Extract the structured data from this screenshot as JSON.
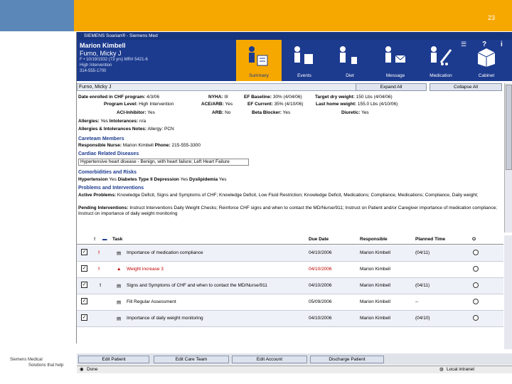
{
  "slide": {
    "number": "23",
    "footer": [
      "Siemens Medical",
      "Solutions that help"
    ]
  },
  "window": {
    "title": "SIEMENS Soarian® - Siemens Med"
  },
  "header": {
    "user_name": "Marion Kimbell",
    "patient_name": "Furno, Micky J",
    "lines": [
      "F • 10/19/1932 (73 yrs) MR# 5421-6",
      "High Intervention",
      "314-555-1700"
    ]
  },
  "nav": {
    "items": [
      {
        "label": "Summary",
        "icon": "summary-person-icon",
        "active": true
      },
      {
        "label": "Events",
        "icon": "events-person-icon"
      },
      {
        "label": "Diet",
        "icon": "diet-person-icon"
      },
      {
        "label": "Message",
        "icon": "message-person-icon"
      },
      {
        "label": "Medication",
        "icon": "medication-person-icon"
      },
      {
        "label": "Cabinet",
        "icon": "cabinet-box-icon"
      }
    ]
  },
  "patient_bar": {
    "name": "Furno, Micky J",
    "expand_label": "Expand All",
    "collapse_label": "Collapse All"
  },
  "summary": {
    "enrolled": {
      "label": "Date enrolled in CHF program:",
      "value": "4/3/06"
    },
    "nyha": {
      "label": "NYHA:",
      "value": "III"
    },
    "ef_baseline": {
      "label": "EF Baseline:",
      "value": "30% (4/04/06)"
    },
    "target_weight": {
      "label": "Target dry weight:",
      "value": "150 Lbs (4/04/06)"
    },
    "program_level": {
      "label": "Program Level:",
      "value": "High Intervention"
    },
    "acearb": {
      "label": "ACE/ARB:",
      "value": "Yes"
    },
    "ef_current": {
      "label": "EF Current:",
      "value": "35% (4/10/06)"
    },
    "last_weight": {
      "label": "Last home weight:",
      "value": "155.0 Lbs (4/10/06)"
    },
    "aci": {
      "label": "ACI-Inhibitor:",
      "value": "Yes"
    },
    "arb": {
      "label": "ARB:",
      "value": "No"
    },
    "beta": {
      "label": "Beta Blocker:",
      "value": "Yes"
    },
    "diuretic": {
      "label": "Diuretic:",
      "value": "Yes"
    },
    "allergies": {
      "label": "Allergies:",
      "value": "Yes",
      "intolerances_label": "Intolerances:",
      "intolerances_value": "n/a"
    },
    "allergy_notes": {
      "label": "Allergies & Intolerances Notes:",
      "value": "Allergy: PCN"
    }
  },
  "careteam": {
    "title": "Careteam Members",
    "nurse_label": "Responsible Nurse:",
    "nurse": "Marion Kimbell",
    "phone_label": "Phone:",
    "phone": "215-555-3300"
  },
  "cardiac": {
    "title": "Cardiac Related Diseases",
    "value": "Hypertensive heart disease - Benign, with heart failure; Left Heart Failure"
  },
  "comorbid": {
    "title": "Comorbidities and Risks",
    "items": [
      {
        "label": "Hypertension",
        "value": "Yes"
      },
      {
        "label": "Diabetes Type II",
        "value": ""
      },
      {
        "label": "Depression",
        "value": "Yes"
      },
      {
        "label": "Dyslipidemia",
        "value": "Yes"
      }
    ]
  },
  "problems": {
    "title": "Problems and Interventions",
    "active_label": "Active Problems:",
    "active": "Knowledge Deficit, Signs and Symptoms of CHF; Knowledge Deficit, Low Fluid Restriction; Knowledge Deficit, Medications; Compliance, Medications; Compliance, Daily weight;",
    "pending_label": "Pending Interventions:",
    "pending": "Instruct Interventions Daily Weight Checks; Reinforce CHF signs and when to contact the MD/Nurse/911; Instruct on Patient and/or Caregiver importance of medication compliance; Instruct on importance of daily weight monitoring"
  },
  "tasks": {
    "headers": {
      "task": "Task",
      "due": "Due Date",
      "resp": "Responsible",
      "planned": "Planned Time",
      "o": "O"
    },
    "rows": [
      {
        "flag": "!",
        "task": "Importance of medication compliance",
        "due": "04/10/2006",
        "resp": "Marion Kimbell",
        "planned": "(04/11)",
        "overdue": false
      },
      {
        "flag": "!",
        "task": "Weight increase 3",
        "due": "04/10/2006",
        "resp": "Marion Kimbell",
        "planned": "",
        "overdue": true
      },
      {
        "flag": "!",
        "task": "Signs and Symptoms of CHF and when to contact the MD/Nurse/911",
        "due": "04/10/2006",
        "resp": "Marion Kimbell",
        "planned": "(04/11)",
        "overdue": false
      },
      {
        "flag": "",
        "task": "Fill Regular Assessment",
        "due": "05/09/2006",
        "resp": "Marion Kimbell",
        "planned": "--",
        "overdue": false
      },
      {
        "flag": "",
        "task": "Importance of daily weight monitoring",
        "due": "04/10/2006",
        "resp": "Marion Kimbell",
        "planned": "(04/10)",
        "overdue": false
      }
    ]
  },
  "bottom_buttons": [
    "Edit Patient",
    "Edit Care Team",
    "Edit Account",
    "Discharge Patient"
  ],
  "status": {
    "left": "Done",
    "right": "Local intranet"
  },
  "colors": {
    "accent": "#f6a800",
    "brand": "#1c3b8f",
    "alert": "#c00000"
  }
}
